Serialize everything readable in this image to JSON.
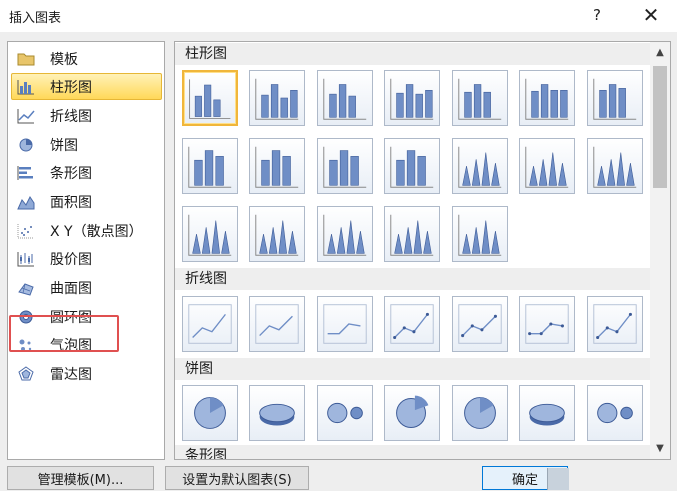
{
  "window": {
    "title": "插入图表",
    "help_label": "?",
    "close_label": "✕"
  },
  "chart_types": [
    {
      "label": "模板",
      "icon": "folder-icon"
    },
    {
      "label": "柱形图",
      "icon": "column-chart-icon",
      "selected": true
    },
    {
      "label": "折线图",
      "icon": "line-chart-icon"
    },
    {
      "label": "饼图",
      "icon": "pie-chart-icon"
    },
    {
      "label": "条形图",
      "icon": "bar-chart-icon"
    },
    {
      "label": "面积图",
      "icon": "area-chart-icon"
    },
    {
      "label": "X Y（散点图）",
      "icon": "scatter-chart-icon"
    },
    {
      "label": "股价图",
      "icon": "stock-chart-icon"
    },
    {
      "label": "曲面图",
      "icon": "surface-chart-icon"
    },
    {
      "label": "圆环图",
      "icon": "doughnut-chart-icon",
      "highlighted": true
    },
    {
      "label": "气泡图",
      "icon": "bubble-chart-icon"
    },
    {
      "label": "雷达图",
      "icon": "radar-chart-icon"
    }
  ],
  "gallery": {
    "groups": [
      {
        "header": "柱形图",
        "thumbnail_count": 19
      },
      {
        "header": "折线图",
        "thumbnail_count": 7
      },
      {
        "header": "饼图",
        "thumbnail_count": 7
      },
      {
        "header": "条形图",
        "thumbnail_count": 0
      }
    ]
  },
  "buttons": {
    "manage_templates": "管理模板(M)...",
    "set_default": "设置为默认图表(S)",
    "ok": "确定"
  },
  "colors": {
    "selection_fill": "#ffd859",
    "highlight_border": "#e05050",
    "thumbnail_blue": "#6f8ec6"
  }
}
